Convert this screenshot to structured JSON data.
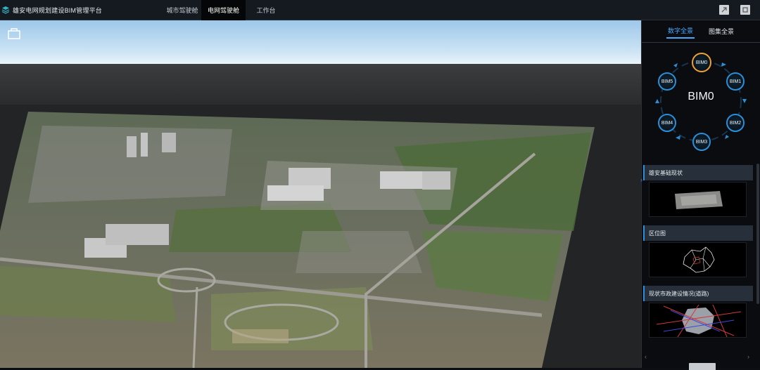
{
  "app": {
    "title": "雄安电网规划建设BIM管理平台"
  },
  "nav": {
    "tabs": [
      {
        "label": "城市驾驶舱",
        "active": false
      },
      {
        "label": "电网驾驶舱",
        "active": true
      },
      {
        "label": "工作台",
        "active": false
      }
    ]
  },
  "toolbar": {
    "icons": [
      "export-icon",
      "fullscreen-icon"
    ]
  },
  "panel": {
    "tabs": [
      {
        "label": "数字全景",
        "active": true
      },
      {
        "label": "图集全景",
        "active": false
      }
    ],
    "bim": {
      "center": "BIM0",
      "nodes": [
        "BIM0",
        "BIM1",
        "BIM2",
        "BIM3",
        "BIM4",
        "BIM5"
      ],
      "active": "BIM0"
    },
    "sections": [
      {
        "title": "雄安基础现状"
      },
      {
        "title": "区位图"
      },
      {
        "title": "现状市政建设情况(道路)"
      }
    ]
  },
  "colors": {
    "accent": "#4aa7ff",
    "active_node": "#f0a030",
    "node_ring": "#2a8fd8"
  }
}
